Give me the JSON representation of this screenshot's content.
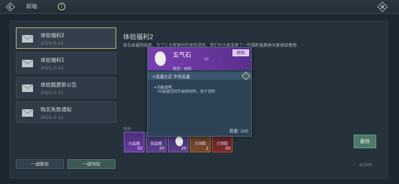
{
  "header": {
    "title": "邮箱",
    "help_glyph": "?"
  },
  "mail_list": [
    {
      "title": "体验福利2",
      "date": "2021-5-11",
      "selected": true
    },
    {
      "title": "体验福利1",
      "date": "2021-5-11",
      "selected": false
    },
    {
      "title": "体验服更新公告",
      "date": "2021-5-11",
      "selected": false
    },
    {
      "title": "购买失败通知",
      "date": "2021-5-11",
      "selected": false
    }
  ],
  "footer": {
    "delete_all": "一键删除",
    "claim_all": "一键领取",
    "count": "4/200"
  },
  "detail": {
    "title": "体验福利2",
    "body": "各位亲爱的玩家，为了让大家更好的体验游戏，我们为大家准备了一些福利道具供大家体验使用",
    "attachments_label": "附件",
    "attachments": [
      {
        "name": "白晶魄",
        "qty": "50",
        "color": "purple"
      },
      {
        "name": "铝晶魄",
        "qty": "20",
        "color": "purple2"
      },
      {
        "name": "",
        "qty": "20",
        "color": "purple2"
      },
      {
        "name": "已领取",
        "qty": "1",
        "color": "orange"
      },
      {
        "name": "已领取",
        "qty": "50",
        "color": "red"
      }
    ],
    "delete_button": "删除"
  },
  "tooltip": {
    "name": "五气石",
    "id": "ID",
    "obtain": "获取",
    "type": "类型：材料",
    "flow": "+流通方式  不可流通",
    "flow_help": "?",
    "desc_label": "+功能说明",
    "desc": "55级激活时开启的材料，用于进阶",
    "qty": "数量: 200"
  }
}
